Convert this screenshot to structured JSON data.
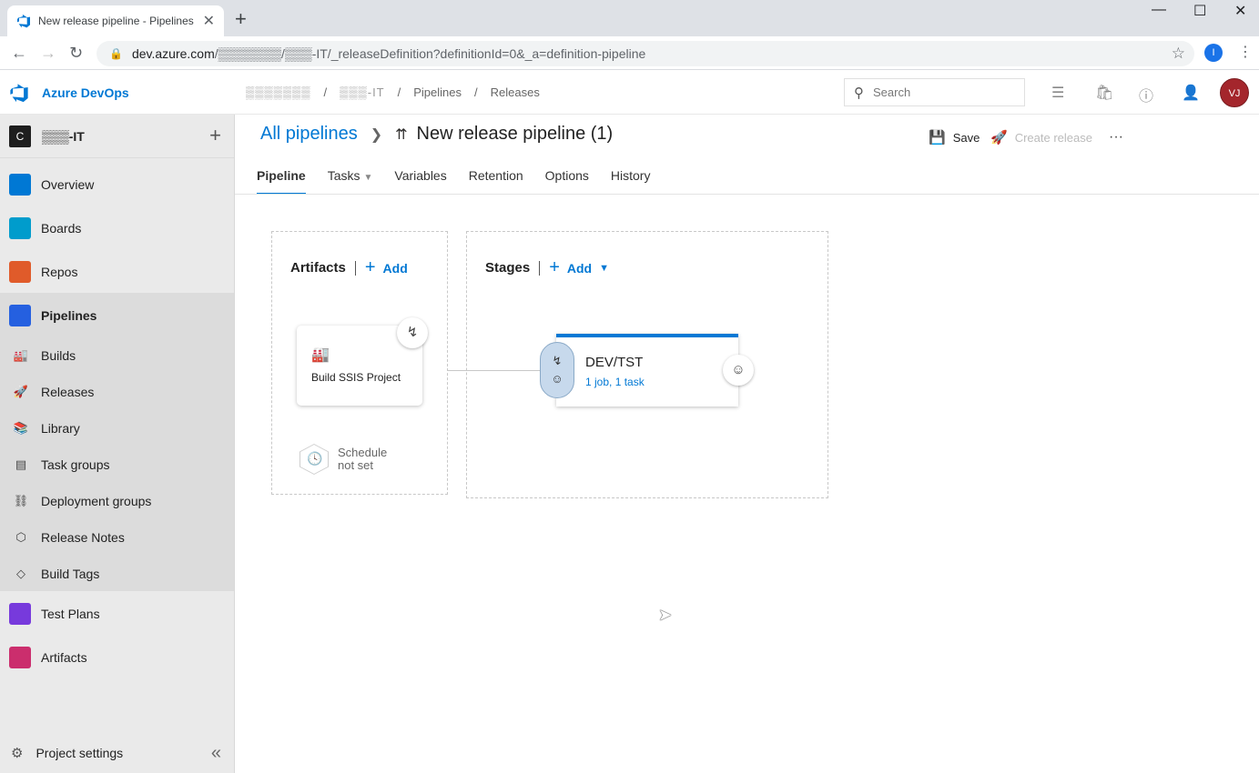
{
  "browser": {
    "tab_title": "New release pipeline - Pipelines",
    "tab_close": "✕",
    "new_tab": "+",
    "url_host": "dev.azure.com",
    "url_path": "/▒▒▒▒▒▒▒/▒▒▒-IT/_releaseDefinition?definitionId=0&_a=definition-pipeline",
    "profile_initial": "I"
  },
  "header": {
    "brand": "Azure DevOps",
    "breadcrumbs": [
      "▒▒▒▒▒▒▒",
      "▒▒▒-IT",
      "Pipelines",
      "Releases"
    ],
    "breadcrumb_sep": "/",
    "search_placeholder": "Search",
    "avatar_initials": "VJ"
  },
  "sidebar": {
    "project_initial": "C",
    "project_name": "▒▒▒-IT",
    "items": [
      {
        "label": "Overview",
        "color": "#0078d4"
      },
      {
        "label": "Boards",
        "color": "#009ccc"
      },
      {
        "label": "Repos",
        "color": "#e05b2a"
      },
      {
        "label": "Pipelines",
        "color": "#2560e0"
      },
      {
        "label": "Test Plans",
        "color": "#773adc"
      },
      {
        "label": "Artifacts",
        "color": "#cb2e6d"
      }
    ],
    "subitems": [
      {
        "label": "Builds",
        "icon": "🏭"
      },
      {
        "label": "Releases",
        "icon": "🚀"
      },
      {
        "label": "Library",
        "icon": "📚"
      },
      {
        "label": "Task groups",
        "icon": "▤"
      },
      {
        "label": "Deployment groups",
        "icon": "⛓"
      },
      {
        "label": "Release Notes",
        "icon": "⬡"
      },
      {
        "label": "Build Tags",
        "icon": "◇"
      }
    ],
    "settings_label": "Project settings"
  },
  "page": {
    "all_pipelines": "All pipelines",
    "title": "New release pipeline (1)",
    "save_label": "Save",
    "create_release_label": "Create release",
    "more": "···",
    "tabs": [
      "Pipeline",
      "Tasks",
      "Variables",
      "Retention",
      "Options",
      "History"
    ],
    "active_tab": "Pipeline"
  },
  "artifacts": {
    "heading": "Artifacts",
    "add_label": "Add",
    "card_name": "Build SSIS Project",
    "schedule_line1": "Schedule",
    "schedule_line2": "not set"
  },
  "stages": {
    "heading": "Stages",
    "add_label": "Add",
    "stage_name": "DEV/TST",
    "stage_summary": "1 job, 1 task"
  }
}
